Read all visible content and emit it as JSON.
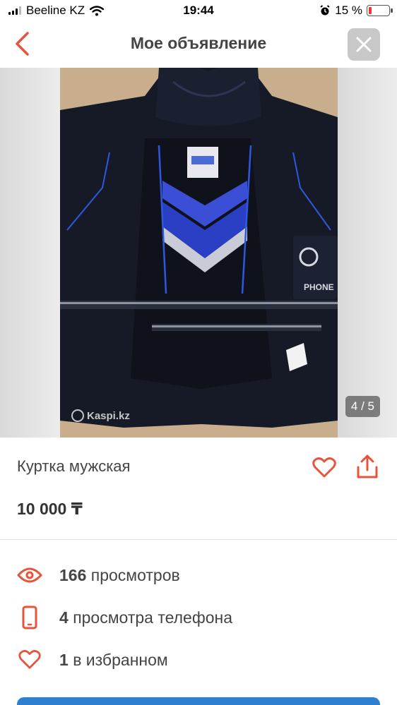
{
  "status_bar": {
    "carrier": "Beeline KZ",
    "time": "19:44",
    "battery_text": "15 %",
    "battery_level": 0.15
  },
  "header": {
    "title": "Мое объявление"
  },
  "photo": {
    "counter": "4 / 5",
    "watermark": "Kaspi.kz",
    "tag_text": "PHONE"
  },
  "listing": {
    "title": "Куртка мужская",
    "price": "10 000 ₸"
  },
  "stats": {
    "views_count": "166",
    "views_label": "просмотров",
    "phone_count": "4",
    "phone_label": "просмотра телефона",
    "fav_count": "1",
    "fav_label": "в избранном"
  },
  "colors": {
    "accent": "#e8533c",
    "primary_button": "#2f7fd0",
    "battery_low": "#e53935"
  },
  "icons": [
    "back-arrow-icon",
    "close-icon",
    "heart-icon",
    "share-icon",
    "eye-icon",
    "phone-icon",
    "wifi-icon",
    "alarm-icon"
  ]
}
